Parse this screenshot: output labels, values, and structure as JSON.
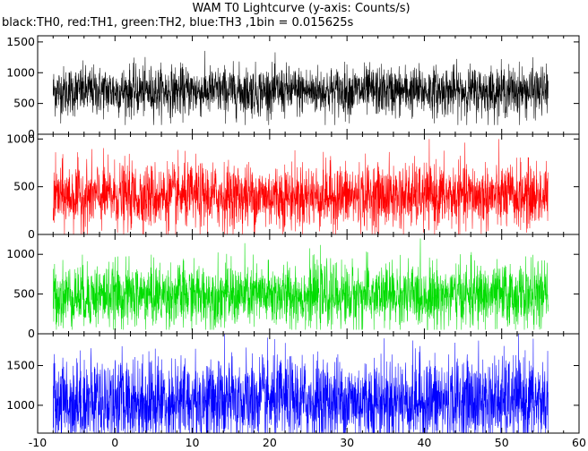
{
  "title": "WAM T0 Lightcurve (y-axis: Counts/s)",
  "subtitle": "black:TH0, red:TH1, green:TH2, blue:TH3 ,1bin = 0.015625s",
  "chart_data": {
    "type": "line",
    "title": "WAM T0 Lightcurve (y-axis: Counts/s)",
    "subtitle": "black:TH0, red:TH1, green:TH2, blue:TH3 ,1bin = 0.015625s",
    "xlabel": "",
    "xlim": [
      -10,
      60
    ],
    "xticks": [
      -10,
      0,
      10,
      20,
      30,
      40,
      50,
      60
    ],
    "bin_size_s": 0.015625,
    "data_range_x": [
      -8,
      56
    ],
    "grid": false,
    "legend": "none (described in subtitle)",
    "panels": [
      {
        "series": "TH0",
        "color": "#000000",
        "ylim": [
          0,
          1600
        ],
        "yticks": [
          0,
          500,
          1000,
          1500
        ],
        "mean": 700,
        "spread": 200,
        "range": [
          150,
          1550
        ]
      },
      {
        "series": "TH1",
        "color": "#ff0000",
        "ylim": [
          0,
          1050
        ],
        "yticks": [
          0,
          500,
          1000
        ],
        "mean": 400,
        "spread": 170,
        "range": [
          0,
          1000
        ]
      },
      {
        "series": "TH2",
        "color": "#00dd00",
        "ylim": [
          0,
          1250
        ],
        "yticks": [
          0,
          500,
          1000
        ],
        "mean": 480,
        "spread": 200,
        "range": [
          50,
          1200
        ]
      },
      {
        "series": "TH3",
        "color": "#0000ff",
        "ylim": [
          650,
          1900
        ],
        "yticks": [
          500,
          1000,
          1500
        ],
        "mean": 1050,
        "spread": 280,
        "range": [
          500,
          1900
        ]
      }
    ]
  }
}
